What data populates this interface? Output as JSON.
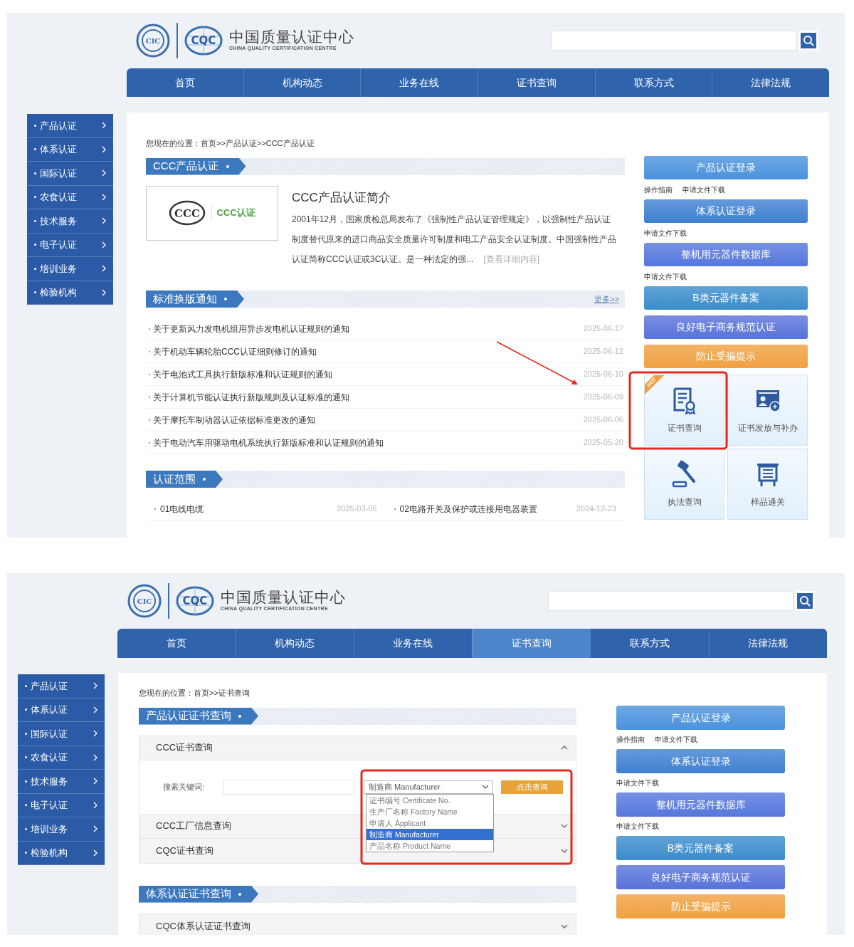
{
  "screens": [
    {
      "header": {
        "logos": [
          {
            "text": "CIC"
          },
          {
            "text": "CQC"
          }
        ],
        "title": "中国质量认证中心",
        "subtitle": "CHINA QUALITY CERTIFICATION CENTRE"
      },
      "nav": [
        {
          "label": "首页",
          "selected": false
        },
        {
          "label": "机构动态",
          "selected": false
        },
        {
          "label": "业务在线",
          "selected": false
        },
        {
          "label": "证书查询",
          "selected": false
        },
        {
          "label": "联系方式",
          "selected": false
        },
        {
          "label": "法律法规",
          "selected": false
        }
      ],
      "sidebar": [
        "产品认证",
        "体系认证",
        "国际认证",
        "农食认证",
        "技术服务",
        "电子认证",
        "培训业务",
        "检验机构"
      ],
      "breadcrumb": "您现在的位置：首页>>产品认证>>CCC产品认证",
      "main": [
        {
          "kind": "intro",
          "title": "CCC产品认证",
          "logo_mark": "CCC",
          "logo_text": "CCC认证",
          "heading": "CCC产品认证简介",
          "text": "2001年12月，国家质检总局发布了《强制性产品认证管理规定》，以强制性产品认证制度替代原来的进口商品安全质量许可制度和电工产品安全认证制度。中国强制性产品认证简称CCC认证或3C认证。是一种法定的强...",
          "link": "[查看详细内容]"
        },
        {
          "kind": "news",
          "title": "标准换版通知",
          "more": "更多>>",
          "items": [
            {
              "title": "关于更新风力发电机组用异步发电机认证规则的通知",
              "date": "2025-06-17"
            },
            {
              "title": "关于机动车辆轮胎CCC认证细则修订的通知",
              "date": "2025-06-12"
            },
            {
              "title": "关于电池式工具执行新版标准和认证规则的通知",
              "date": "2025-06-10"
            },
            {
              "title": "关于计算机节能认证执行新版规则及认证标准的通知",
              "date": "2025-06-09"
            },
            {
              "title": "关于摩托车制动器认证依据标准更改的通知",
              "date": "2025-06-06"
            },
            {
              "title": "关于电动汽车用驱动电机系统执行新版标准和认证规则的通知",
              "date": "2025-05-20"
            }
          ]
        },
        {
          "kind": "range",
          "title": "认证范围",
          "items": [
            {
              "title": "01电线电缆",
              "date": "2025-03-05"
            },
            {
              "title": "02电路开关及保护或连接用电器装置",
              "date": "2024-12-23"
            }
          ]
        }
      ],
      "side": [
        {
          "kind": "button",
          "label": "产品认证登录",
          "color": "#4a92dc"
        },
        {
          "kind": "links",
          "items": [
            "操作指南",
            "申请文件下载"
          ]
        },
        {
          "kind": "button",
          "label": "体系认证登录",
          "color": "#3f80d2"
        },
        {
          "kind": "links",
          "items": [
            "申请文件下载"
          ]
        },
        {
          "kind": "button",
          "label": "整机用元器件数据库",
          "color": "#5576dc"
        },
        {
          "kind": "links",
          "items": [
            "申请文件下载"
          ]
        },
        {
          "kind": "button",
          "label": "B类元器件备案",
          "color": "#3a8ccb"
        },
        {
          "kind": "button",
          "label": "良好电子商务规范认证",
          "color": "#5872da"
        },
        {
          "kind": "button",
          "label": "防止受骗提示",
          "color": "#f0a040"
        },
        {
          "kind": "tiles",
          "items": [
            {
              "label": "证书查询",
              "badge": "HOT"
            },
            {
              "label": "证书发放与补办"
            },
            {
              "label": "执法查询"
            },
            {
              "label": "样品通关"
            }
          ]
        }
      ],
      "annotations": [
        {
          "kind": "arrow"
        },
        {
          "kind": "box"
        }
      ]
    },
    {
      "header": {
        "logos": [
          {
            "text": "CIC"
          },
          {
            "text": "CQC"
          }
        ],
        "title": "中国质量认证中心",
        "subtitle": "CHINA QUALITY CERTIFICATION CENTRE"
      },
      "nav": [
        {
          "label": "首页",
          "selected": false
        },
        {
          "label": "机构动态",
          "selected": false
        },
        {
          "label": "业务在线",
          "selected": false
        },
        {
          "label": "证书查询",
          "selected": true
        },
        {
          "label": "联系方式",
          "selected": false
        },
        {
          "label": "法律法规",
          "selected": false
        }
      ],
      "sidebar": [
        "产品认证",
        "体系认证",
        "国际认证",
        "农食认证",
        "技术服务",
        "电子认证",
        "培训业务",
        "检验机构"
      ],
      "breadcrumb": "您现在的位置：首页>>证书查询",
      "main": [
        {
          "kind": "query",
          "title": "产品认证证书查询",
          "panels": [
            {
              "title": "CCC证书查询",
              "expanded": true,
              "form": {
                "label": "搜索关键词:",
                "select": "制造商 Manufacturer",
                "options": [
                  {
                    "label": "证书编号 Certificate No.",
                    "selected": false
                  },
                  {
                    "label": "生产厂名称 Factory Name",
                    "selected": false
                  },
                  {
                    "label": "申请人 Applicant",
                    "selected": false
                  },
                  {
                    "label": "制造商 Manufacturer",
                    "selected": true
                  },
                  {
                    "label": "产品名称 Product Name",
                    "selected": false
                  }
                ],
                "button": "点击查询"
              }
            },
            {
              "title": "CCC工厂信息查询",
              "expanded": false
            },
            {
              "title": "CQC证书查询",
              "expanded": false
            }
          ]
        },
        {
          "kind": "query",
          "title": "体系认证证书查询",
          "panels": [
            {
              "title": "CQC体系认证证书查询",
              "expanded": false
            }
          ]
        }
      ],
      "side": [
        {
          "kind": "button",
          "label": "产品认证登录",
          "color": "#4a92dc"
        },
        {
          "kind": "links",
          "items": [
            "操作指南",
            "申请文件下载"
          ]
        },
        {
          "kind": "button",
          "label": "体系认证登录",
          "color": "#3f80d2"
        },
        {
          "kind": "links",
          "items": [
            "申请文件下载"
          ]
        },
        {
          "kind": "button",
          "label": "整机用元器件数据库",
          "color": "#5576dc"
        },
        {
          "kind": "links",
          "items": [
            "申请文件下载"
          ]
        },
        {
          "kind": "button",
          "label": "B类元器件备案",
          "color": "#3a8ccb"
        },
        {
          "kind": "button",
          "label": "良好电子商务规范认证",
          "color": "#5872da"
        },
        {
          "kind": "button",
          "label": "防止受骗提示",
          "color": "#f0a040"
        }
      ],
      "annotations": [
        {
          "kind": "box"
        }
      ]
    }
  ]
}
